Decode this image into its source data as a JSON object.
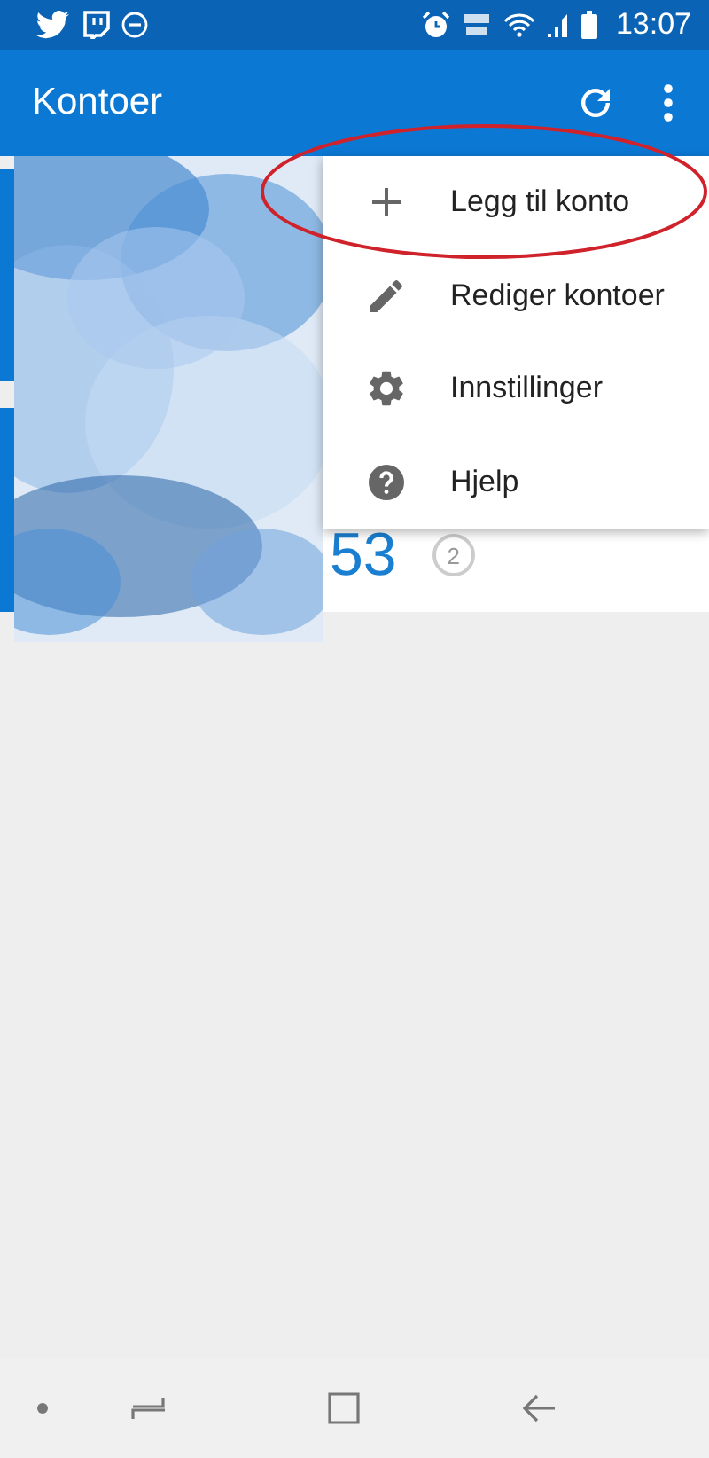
{
  "status_bar": {
    "time": "13:07"
  },
  "app_bar": {
    "title": "Kontoer"
  },
  "account": {
    "amount": "53",
    "badge": "2"
  },
  "menu": {
    "items": [
      {
        "kind": "add",
        "label": "Legg til konto",
        "highlighted": true
      },
      {
        "kind": "edit",
        "label": "Rediger kontoer",
        "highlighted": false
      },
      {
        "kind": "settings",
        "label": "Innstillinger",
        "highlighted": false
      },
      {
        "kind": "help",
        "label": "Hjelp",
        "highlighted": false
      }
    ]
  }
}
